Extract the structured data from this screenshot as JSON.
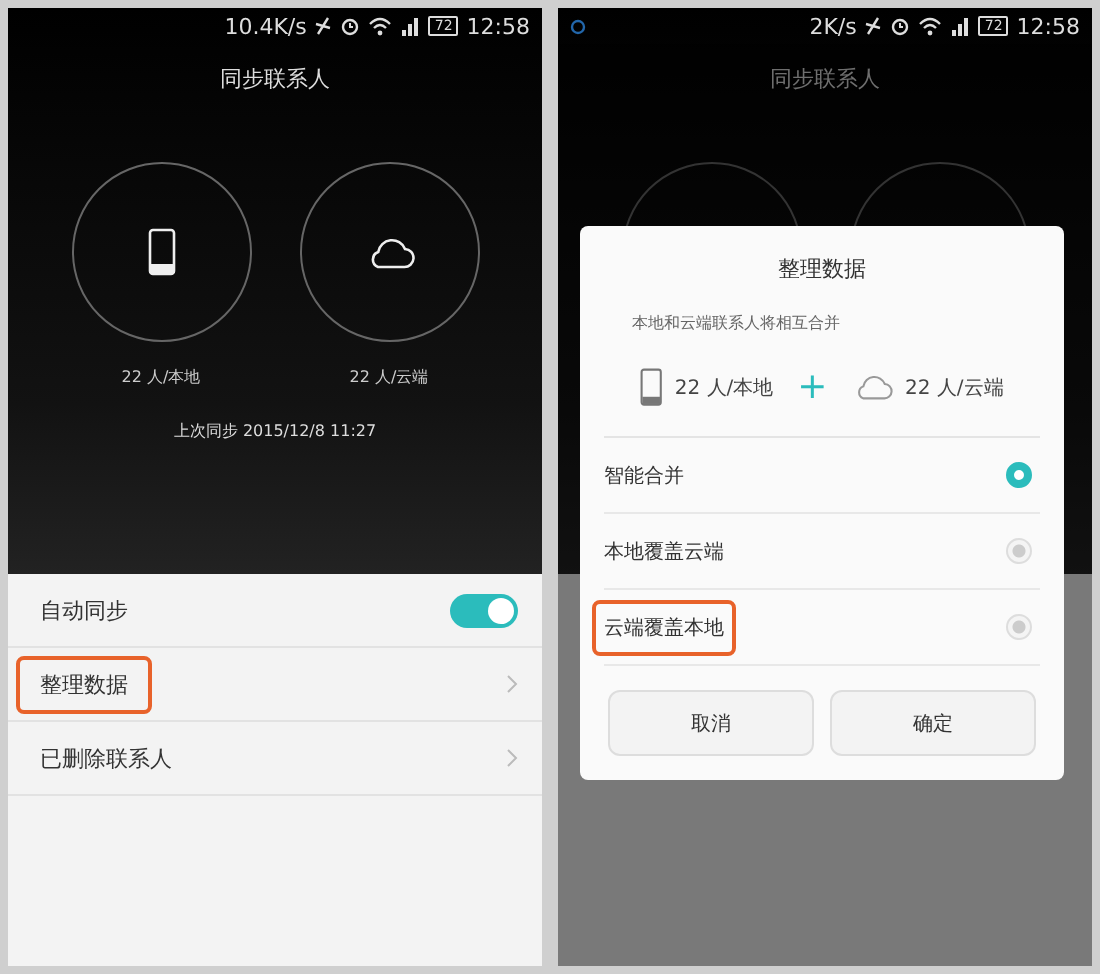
{
  "screens": [
    {
      "status_bar": {
        "speed": "10.4K/s",
        "battery": "72",
        "time": "12:58",
        "notification_icon": false
      },
      "title": "同步联系人",
      "counters": [
        {
          "kind": "phone",
          "label": "22 人/本地"
        },
        {
          "kind": "cloud",
          "label": "22 人/云端"
        }
      ],
      "last_sync": "上次同步 2015/12/8 11:27",
      "settings": [
        {
          "kind": "toggle",
          "label": "自动同步",
          "on": true,
          "highlighted": false
        },
        {
          "kind": "link",
          "label": "整理数据",
          "highlighted": true
        },
        {
          "kind": "link",
          "label": "已删除联系人",
          "highlighted": false
        }
      ]
    },
    {
      "status_bar": {
        "speed": "2K/s",
        "battery": "72",
        "time": "12:58",
        "notification_icon": true
      },
      "title": "同步联系人",
      "dialog": {
        "title": "整理数据",
        "description": "本地和云端联系人将相互合并",
        "merge": {
          "local": "22 人/本地",
          "plus": "+",
          "cloud": "22 人/云端"
        },
        "options": [
          {
            "label": "智能合并",
            "selected": true,
            "highlighted": false
          },
          {
            "label": "本地覆盖云端",
            "selected": false,
            "highlighted": false
          },
          {
            "label": "云端覆盖本地",
            "selected": false,
            "highlighted": true
          }
        ],
        "buttons": [
          "取消",
          "确定"
        ]
      }
    }
  ]
}
